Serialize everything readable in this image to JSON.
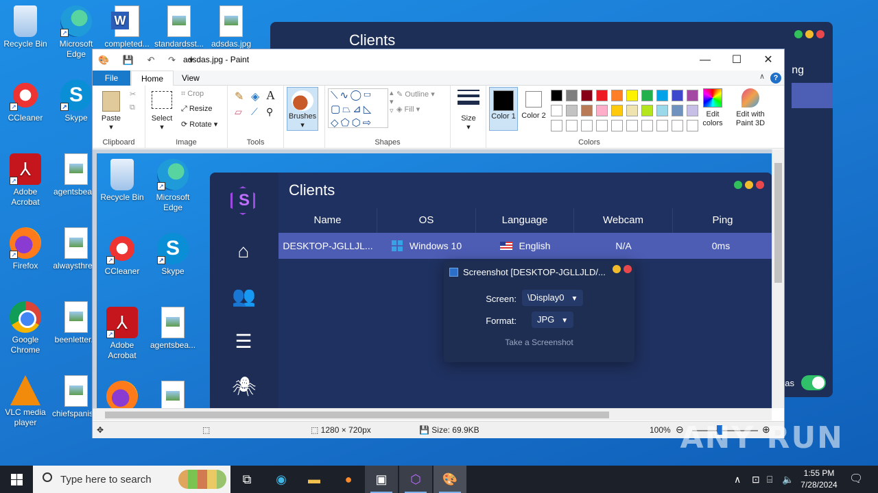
{
  "desktop": {
    "col1": [
      {
        "label": "Recycle Bin",
        "icon": "recycle-bin-icon"
      },
      {
        "label": "Microsoft Edge",
        "icon": "edge-icon"
      },
      {
        "label": "CCleaner",
        "icon": "ccleaner-icon"
      },
      {
        "label": "Skype",
        "icon": "skype-icon"
      },
      {
        "label": "Adobe Acrobat",
        "icon": "acrobat-icon"
      },
      {
        "label": "agentsbea...",
        "icon": "file-icon"
      },
      {
        "label": "Firefox",
        "icon": "firefox-icon"
      },
      {
        "label": "alwaysthre...",
        "icon": "file-icon"
      },
      {
        "label": "Google Chrome",
        "icon": "chrome-icon"
      },
      {
        "label": "beenletter...",
        "icon": "file-icon"
      },
      {
        "label": "VLC media player",
        "icon": "vlc-icon"
      },
      {
        "label": "chiefspanis...",
        "icon": "file-icon"
      }
    ],
    "top_row": [
      {
        "label": "completed...",
        "icon": "word-icon"
      },
      {
        "label": "standardsst...",
        "icon": "file-icon"
      },
      {
        "label": "adsdas.jpg",
        "icon": "file-icon"
      }
    ]
  },
  "bg_app": {
    "title": "Clients",
    "partial_header": "ng",
    "partial_label": "as"
  },
  "paint": {
    "title": "adsdas.jpg - Paint",
    "tabs": {
      "file": "File",
      "home": "Home",
      "view": "View"
    },
    "clipboard": {
      "paste": "Paste",
      "group": "Clipboard"
    },
    "image": {
      "select": "Select",
      "crop": "Crop",
      "resize": "Resize",
      "rotate": "Rotate",
      "group": "Image"
    },
    "tools": {
      "group": "Tools"
    },
    "brushes": "Brushes",
    "shapes": {
      "outline": "Outline",
      "fill": "Fill",
      "group": "Shapes"
    },
    "size": "Size",
    "color1": "Color 1",
    "color2": "Color 2",
    "colors_group": "Colors",
    "edit_colors": "Edit colors",
    "edit_3d": "Edit with Paint 3D",
    "palette": [
      "#000000",
      "#7f7f7f",
      "#880015",
      "#ed1c24",
      "#ff7f27",
      "#fff200",
      "#22b14c",
      "#00a2e8",
      "#3f48cc",
      "#a349a4",
      "#ffffff",
      "#c3c3c3",
      "#b97a57",
      "#ffaec9",
      "#ffc90e",
      "#efe4b0",
      "#b5e61d",
      "#99d9ea",
      "#7092be",
      "#c8bfe7"
    ],
    "status": {
      "dimensions": "1280 × 720px",
      "size": "Size: 69.9KB",
      "zoom": "100%"
    }
  },
  "image": {
    "desktop_icons": [
      {
        "label": "Recycle Bin"
      },
      {
        "label": "Microsoft Edge"
      },
      {
        "label": "CCleaner"
      },
      {
        "label": "Skype"
      },
      {
        "label": "Adobe Acrobat"
      },
      {
        "label": "agentsbea..."
      }
    ],
    "app": {
      "title": "Clients",
      "columns": [
        "Name",
        "OS",
        "Language",
        "Webcam",
        "Ping"
      ],
      "row": {
        "name": "DESKTOP-JGLLJL...",
        "os": "Windows 10",
        "language": "English",
        "webcam": "N/A",
        "ping": "0ms"
      }
    },
    "dialog": {
      "title": "Screenshot [DESKTOP-JGLLJLD/...",
      "screen_label": "Screen:",
      "screen_value": "\\Display0",
      "format_label": "Format:",
      "format_value": "JPG",
      "button": "Take a Screenshot"
    }
  },
  "watermark": "ANY RUN",
  "taskbar": {
    "search_placeholder": "Type here to search",
    "time": "1:55 PM",
    "date": "7/28/2024"
  }
}
